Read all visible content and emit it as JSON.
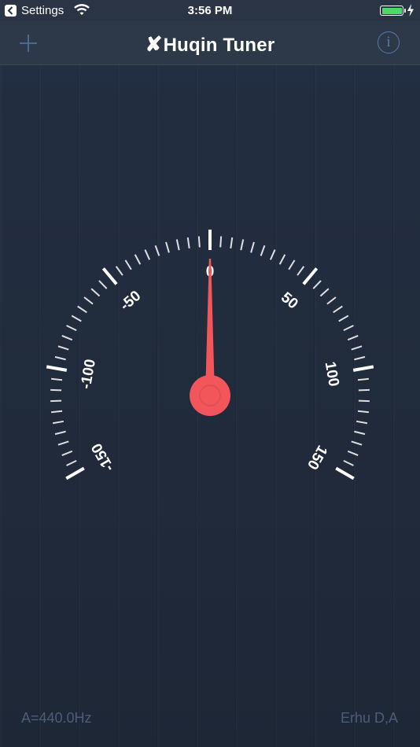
{
  "status_bar": {
    "back_app": "Settings",
    "time": "3:56 PM"
  },
  "nav": {
    "title_mark": "✘",
    "title": "Huqin Tuner",
    "info_label": "i"
  },
  "tuner": {
    "scale_min": -150,
    "scale_max": 150,
    "labels": [
      "-150",
      "-100",
      "-50",
      "0",
      "50",
      "100",
      "150"
    ],
    "cents_deviation": 0,
    "needle_color": "#f2565b"
  },
  "footer": {
    "reference_pitch": "A=440.0Hz",
    "instrument": "Erhu D,A"
  },
  "colors": {
    "background": "#1f2836",
    "nav_bar": "#2d3848",
    "accent_blue": "#5a7aa8",
    "muted_text": "#4c5d78",
    "battery": "#4cd964"
  }
}
